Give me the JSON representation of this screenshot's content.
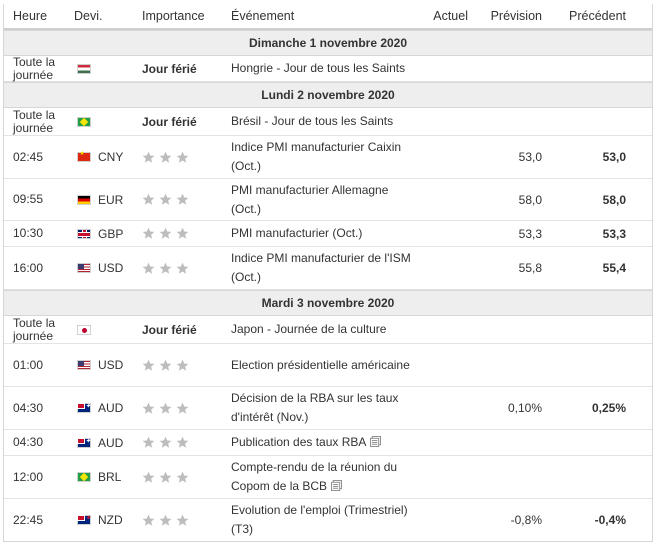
{
  "headers": {
    "time": "Heure",
    "currency": "Devi.",
    "importance": "Importance",
    "event": "Événement",
    "actual": "Actuel",
    "forecast": "Prévision",
    "previous": "Précédent"
  },
  "days": [
    {
      "label": "Dimanche 1 novembre 2020",
      "events": [
        {
          "time": "Toute la journée",
          "flag": "hu-flag-icon",
          "currency": "",
          "importance": "Jour férié",
          "event": "Hongrie - Jour de tous les Saints",
          "actual": "",
          "forecast": "",
          "previous": ""
        }
      ]
    },
    {
      "label": "Lundi 2 novembre 2020",
      "events": [
        {
          "time": "Toute la journée",
          "flag": "br-flag-icon",
          "currency": "",
          "importance": "Jour férié",
          "event": "Brésil - Jour de tous les Saints",
          "actual": "",
          "forecast": "",
          "previous": ""
        },
        {
          "time": "02:45",
          "flag": "cn-flag-icon",
          "currency": "CNY",
          "importance": "3-stars",
          "event": "Indice PMI manufacturier Caixin (Oct.)",
          "actual": "",
          "forecast": "53,0",
          "previous": "53,0"
        },
        {
          "time": "09:55",
          "flag": "de-flag-icon",
          "currency": "EUR",
          "importance": "3-stars",
          "event": "PMI manufacturier Allemagne (Oct.)",
          "actual": "",
          "forecast": "58,0",
          "previous": "58,0"
        },
        {
          "time": "10:30",
          "flag": "gb-flag-icon",
          "currency": "GBP",
          "importance": "3-stars",
          "event": "PMI manufacturier (Oct.)",
          "actual": "",
          "forecast": "53,3",
          "previous": "53,3"
        },
        {
          "time": "16:00",
          "flag": "us-flag-icon",
          "currency": "USD",
          "importance": "3-stars",
          "event": "Indice PMI manufacturier de l'ISM (Oct.)",
          "actual": "",
          "forecast": "55,8",
          "previous": "55,4"
        }
      ]
    },
    {
      "label": "Mardi 3 novembre 2020",
      "events": [
        {
          "time": "Toute la journée",
          "flag": "jp-flag-icon",
          "currency": "",
          "importance": "Jour férié",
          "event": "Japon - Journée de la culture",
          "actual": "",
          "forecast": "",
          "previous": ""
        },
        {
          "time": "01:00",
          "flag": "us-flag-icon",
          "currency": "USD",
          "importance": "3-stars",
          "event": "Election présidentielle américaine",
          "actual": "",
          "forecast": "",
          "previous": ""
        },
        {
          "time": "04:30",
          "flag": "au-flag-icon",
          "currency": "AUD",
          "importance": "3-stars",
          "event": "Décision de la RBA sur les taux d'intérêt (Nov.)",
          "actual": "",
          "forecast": "0,10%",
          "previous": "0,25%"
        },
        {
          "time": "04:30",
          "flag": "au-flag-icon",
          "currency": "AUD",
          "importance": "3-stars",
          "event": "Publication des taux RBA",
          "doc": "document-icon",
          "actual": "",
          "forecast": "",
          "previous": ""
        },
        {
          "time": "12:00",
          "flag": "br-flag-icon",
          "currency": "BRL",
          "importance": "3-stars",
          "event": "Compte-rendu de la réunion du Copom de la BCB",
          "doc": "document-icon",
          "actual": "",
          "forecast": "",
          "previous": ""
        },
        {
          "time": "22:45",
          "flag": "nz-flag-icon",
          "currency": "NZD",
          "importance": "3-stars",
          "event": "Evolution de l'emploi (Trimestriel) (T3)",
          "actual": "",
          "forecast": "-0,8%",
          "previous": "-0,4%"
        }
      ]
    }
  ]
}
